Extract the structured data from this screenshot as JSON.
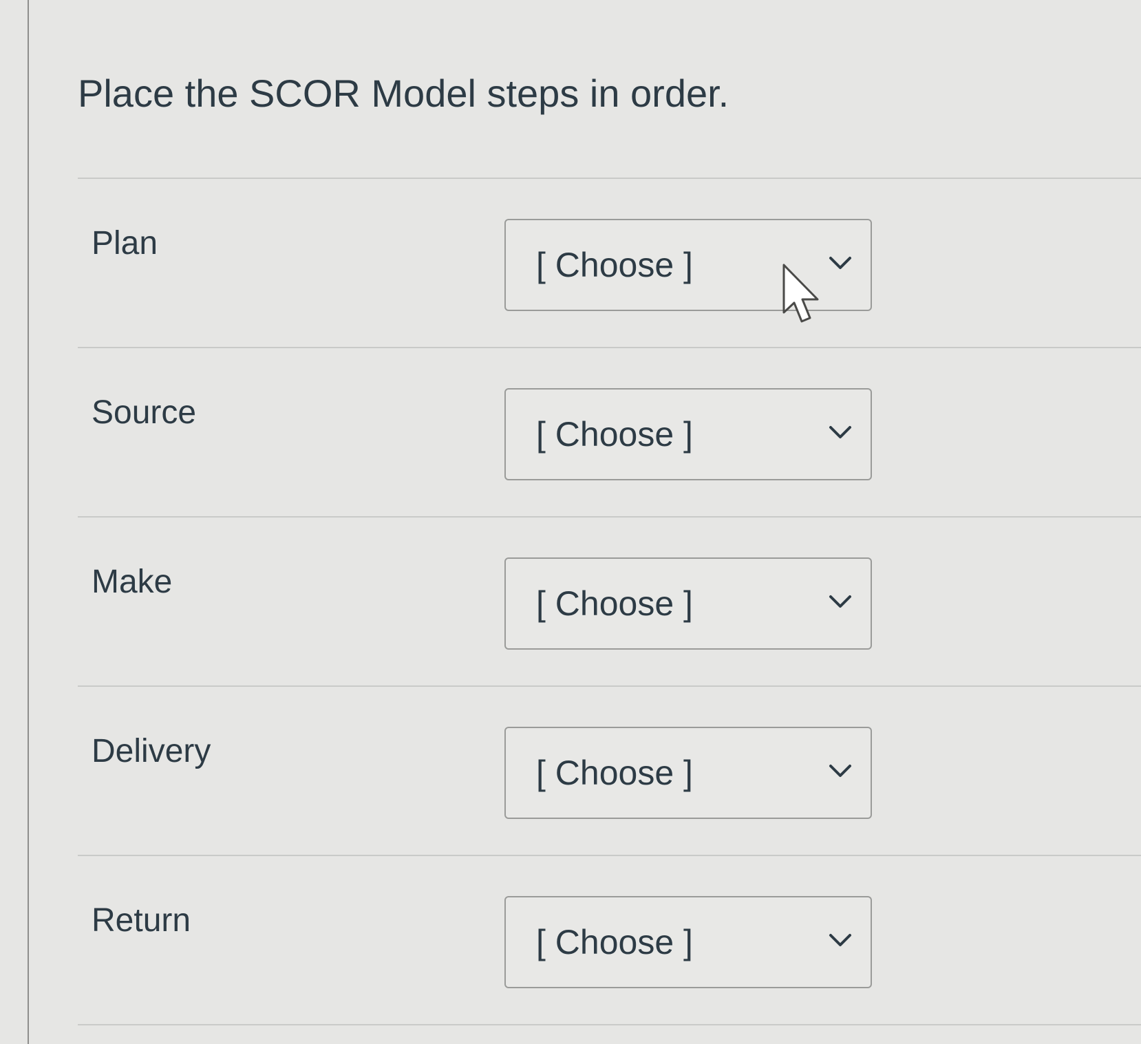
{
  "question": {
    "title": "Place the SCOR Model steps in order."
  },
  "rows": [
    {
      "label": "Plan",
      "selected": "[ Choose ]"
    },
    {
      "label": "Source",
      "selected": "[ Choose ]"
    },
    {
      "label": "Make",
      "selected": "[ Choose ]"
    },
    {
      "label": "Delivery",
      "selected": "[ Choose ]"
    },
    {
      "label": "Return",
      "selected": "[ Choose ]"
    }
  ],
  "icons": {
    "dropdown": "chevron-down-icon",
    "pointer": "mouse-cursor-icon"
  },
  "colors": {
    "background": "#e6e6e4",
    "text": "#2d3b45",
    "border": "#9a9b99",
    "divider": "#c9cac8"
  }
}
